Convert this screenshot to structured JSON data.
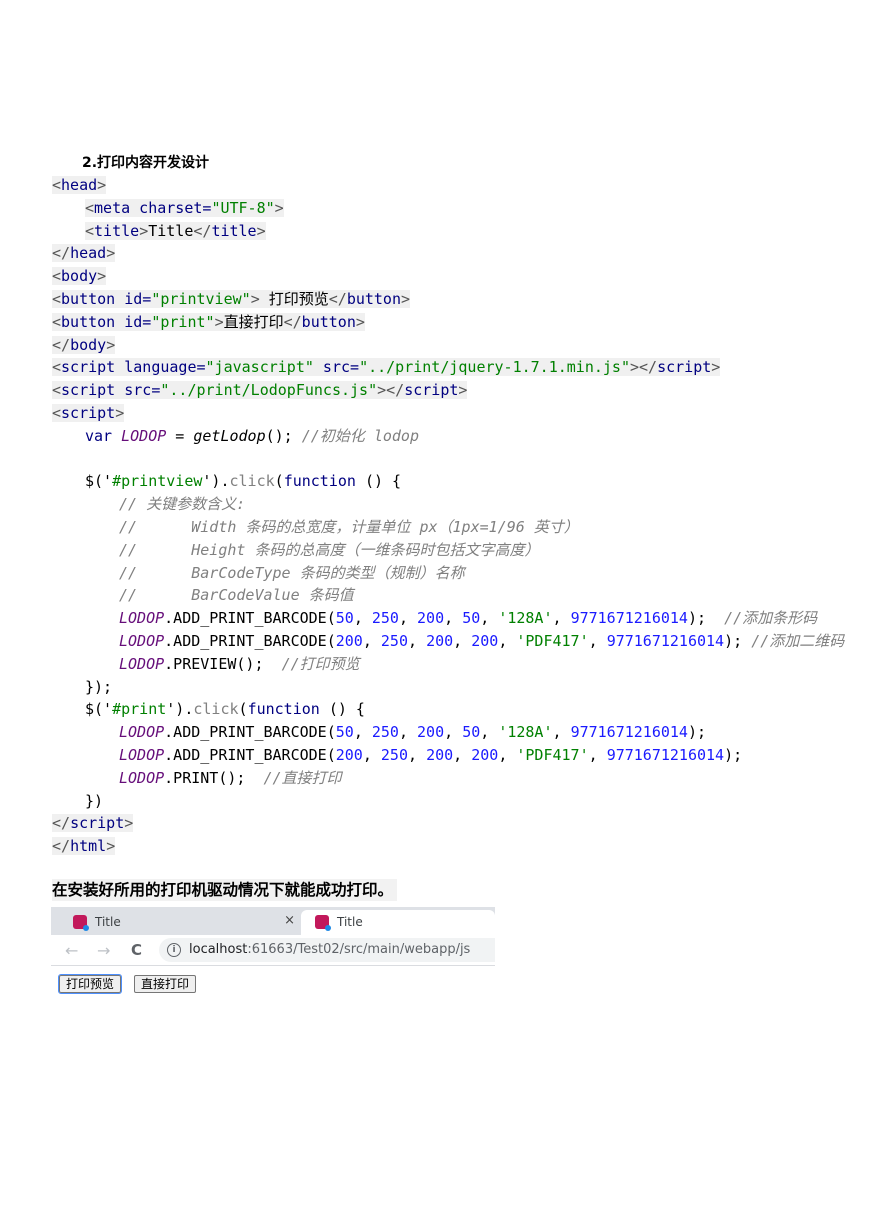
{
  "heading": "2.打印内容开发设计",
  "code": {
    "l1": "head",
    "l2_tag": "meta",
    "l2_attr": " charset=",
    "l2_val": "\"UTF-8\"",
    "l3_tag": "title",
    "l3_text": "Title",
    "l4": "head",
    "l5": "body",
    "l6_tag": "button",
    "l6_attr": " id=",
    "l6_val": "\"printview\"",
    "l6_text": " 打印预览",
    "l7_tag": "button",
    "l7_attr": " id=",
    "l7_val": "\"print\"",
    "l7_text": "直接打印",
    "l8": "body",
    "l9_tag": "script",
    "l9_attr1": " language=",
    "l9_val1": "\"javascript\"",
    "l9_attr2": " src=",
    "l9_val2": "\"../print/jquery-1.7.1.min.js\"",
    "l10_tag": "script",
    "l10_attr": " src=",
    "l10_val": "\"../print/LodopFuncs.js\"",
    "l11": "script",
    "l12_kw": "var",
    "l12_var": "LODOP",
    "l12_op": " = ",
    "l12_fn": "getLodop",
    "l12_tail": "(); ",
    "l12_cm": "//初始化 lodop",
    "l14_a": "$('",
    "l14_sel": "#printview",
    "l14_b": "').",
    "l14_m": "click",
    "l14_c": "(",
    "l14_kw": "function",
    "l14_d": " () {",
    "l15": "// 关键参数含义:",
    "l16": "//      Width 条码的总宽度，计量单位 px（1px=1/96 英寸）",
    "l17": "//      Height 条码的总高度（一维条码时包括文字高度）",
    "l18": "//      BarCodeType 条码的类型（规制）名称",
    "l19": "//      BarCodeValue 条码值",
    "lodop": "LODOP",
    "add": ".ADD_PRINT_BARCODE(",
    "n50": "50",
    "n250": "250",
    "n200": "200",
    "s128": "'128A'",
    "spdf": "'PDF417'",
    "nval": "9771671216014",
    "sep": ", ",
    "l20_end": ");  ",
    "l20_cm": "//添加条形码",
    "l21_end": "); ",
    "l21_cm": "//添加二维码",
    "l22_m": ".PREVIEW();  ",
    "l22_cm": "//打印预览",
    "l23": "});",
    "l24_a": "$('",
    "l24_sel": "#print",
    "l24_b": "').",
    "l24_m": "click",
    "l24_c": "(",
    "l24_kw": "function",
    "l24_d": " () {",
    "l25_end": ");",
    "l26_end": ");",
    "l27_m": ".PRINT();  ",
    "l27_cm": "//直接打印",
    "l28": "})",
    "l29": "script",
    "l30": "html"
  },
  "note": "在安装好所用的打印机驱动情况下就能成功打印。",
  "browser": {
    "tab_inactive": "Title",
    "tab_active": "Title",
    "back_icon": "←",
    "forward_icon": "→",
    "reload_icon": "C",
    "close_icon": "×",
    "info_icon": "i",
    "url_host": "localhost",
    "url_rest": ":61663/Test02/src/main/webapp/js",
    "btn_preview": "打印预览",
    "btn_print": "直接打印"
  },
  "colors": {
    "tag": "#000080",
    "string": "#008000",
    "number": "#1a1aff",
    "variable": "#660e7a",
    "comment": "#808080"
  }
}
